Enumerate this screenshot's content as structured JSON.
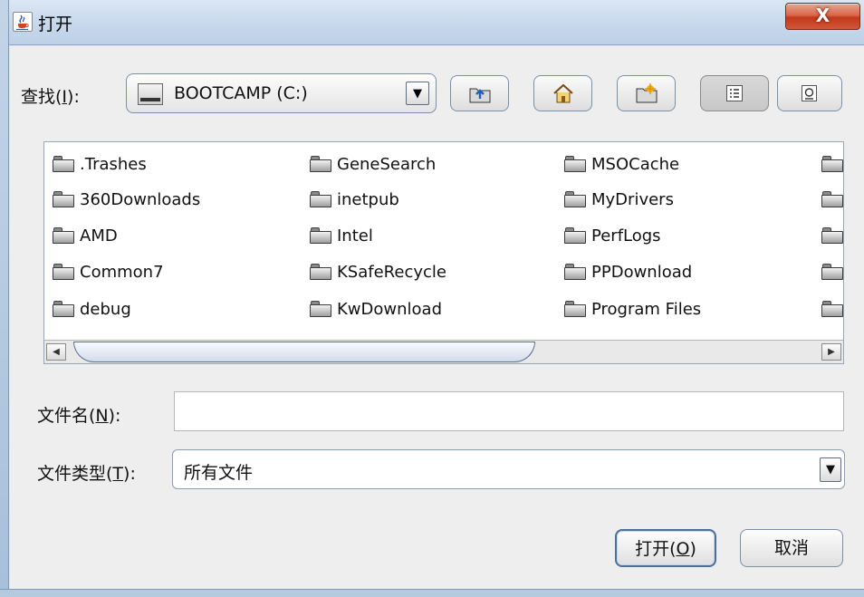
{
  "window": {
    "title": "打开",
    "close_label": "X"
  },
  "lookin": {
    "label_prefix": "查找(",
    "label_mnemonic": "I",
    "label_suffix": "):",
    "value": "BOOTCAMP (C:)"
  },
  "toolbar": {
    "buttons": [
      {
        "name": "up-one-level-button",
        "icon": "folder-up-icon"
      },
      {
        "name": "home-button",
        "icon": "home-icon"
      },
      {
        "name": "new-folder-button",
        "icon": "new-folder-icon"
      },
      {
        "name": "list-view-button",
        "icon": "list-view-icon",
        "pressed": true
      },
      {
        "name": "details-view-button",
        "icon": "details-view-icon"
      }
    ]
  },
  "files": {
    "columns": [
      [
        ".Trashes",
        "360Downloads",
        "AMD",
        "Common7",
        "debug"
      ],
      [
        "GeneSearch",
        "inetpub",
        "Intel",
        "KSafeRecycle",
        "KwDownload"
      ],
      [
        "MSOCache",
        "MyDrivers",
        "PerfLogs",
        "PPDownload",
        "Program Files"
      ]
    ]
  },
  "filename": {
    "label_prefix": "文件名(",
    "label_mnemonic": "N",
    "label_suffix": "):",
    "value": ""
  },
  "filetype": {
    "label_prefix": "文件类型(",
    "label_mnemonic": "T",
    "label_suffix": "):",
    "value": "所有文件"
  },
  "buttons": {
    "open_prefix": "打开(",
    "open_mnemonic": "O",
    "open_suffix": ")",
    "cancel": "取消"
  }
}
